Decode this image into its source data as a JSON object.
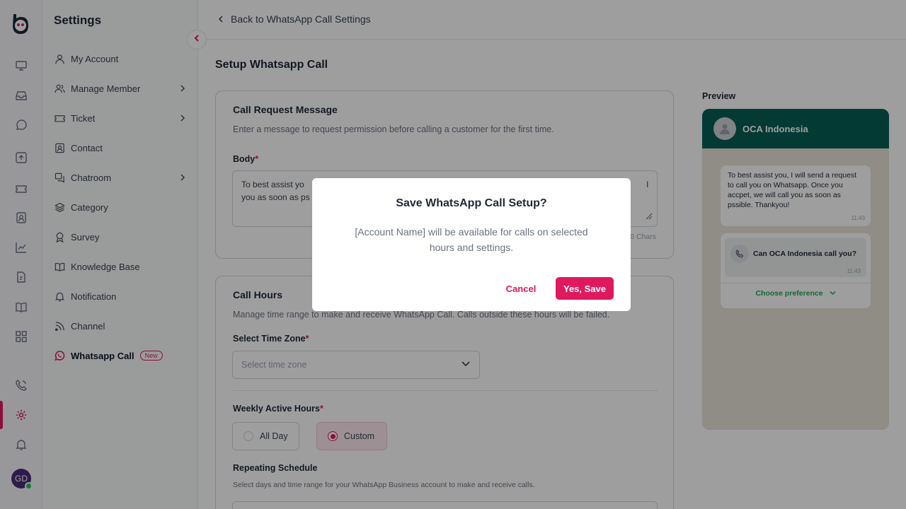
{
  "sidebar": {
    "title": "Settings",
    "items": [
      {
        "label": "My Account",
        "icon": "user-icon"
      },
      {
        "label": "Manage Member",
        "icon": "users-icon",
        "has_submenu": true
      },
      {
        "label": "Ticket",
        "icon": "ticket-icon",
        "has_submenu": true
      },
      {
        "label": "Contact",
        "icon": "contact-icon"
      },
      {
        "label": "Chatroom",
        "icon": "chatroom-icon",
        "has_submenu": true
      },
      {
        "label": "Category",
        "icon": "layers-icon"
      },
      {
        "label": "Survey",
        "icon": "award-icon"
      },
      {
        "label": "Knowledge Base",
        "icon": "book-icon"
      },
      {
        "label": "Notification",
        "icon": "bell-icon"
      },
      {
        "label": "Channel",
        "icon": "rss-icon"
      },
      {
        "label": "Whatsapp Call",
        "icon": "whatsapp-icon",
        "active": true,
        "badge": "New"
      }
    ]
  },
  "rail": {
    "avatar_initials": "GD",
    "accent": "#e0195e"
  },
  "header": {
    "back_label": "Back to WhatsApp Call Settings"
  },
  "main": {
    "page_title": "Setup Whatsapp Call",
    "call_request": {
      "title": "Call Request Message",
      "description": "Enter a message to request permission before calling a customer for the first time.",
      "body_label": "Body",
      "required_mark": "*",
      "body_line1_start": "To best assist yo",
      "body_line1_end": "l",
      "body_line2": "you as soon as ps",
      "chars_fragment": "0 Chars"
    },
    "call_hours": {
      "title": "Call Hours",
      "description": "Manage time range to make and receive WhatsApp Call. Calls outside these hours will be failed.",
      "timezone_label": "Select Time Zone",
      "timezone_placeholder": "Select time zone",
      "weekly_label": "Weekly Active Hours",
      "option_all_day": "All Day",
      "option_custom": "Custom",
      "repeating_label": "Repeating Schedule",
      "repeating_desc": "Select days and time range for your WhatsApp Business account to make and receive calls."
    }
  },
  "preview": {
    "label": "Preview",
    "contact_name": "OCA Indonesia",
    "header_color": "#075e54",
    "message": "To best assist you, I will send a request to call you on Whatsapp. Once you accpet, we will call you as soon as pssible. Thankyou!",
    "message_time": "11:43",
    "call_question": "Can OCA Indonesia call you?",
    "call_time": "11:43",
    "choose_label": "Choose preference"
  },
  "modal": {
    "title": "Save WhatsApp Call Setup?",
    "body": "[Account Name] will be available for calls on selected hours and settings.",
    "cancel_label": "Cancel",
    "confirm_label": "Yes, Save"
  }
}
